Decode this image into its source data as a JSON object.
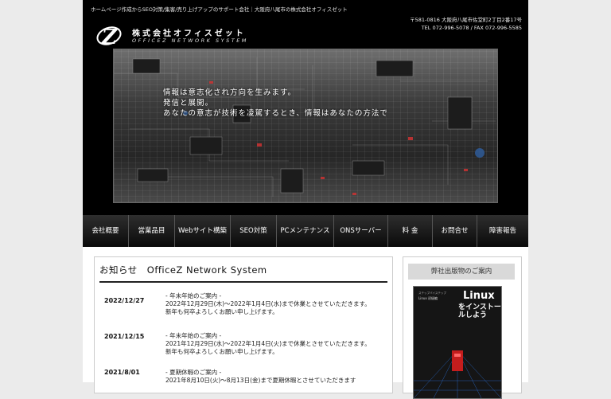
{
  "header": {
    "tagline": "ホームページ作成からSEO対策/集客/売り上げアップのサポート会社｜大阪府八尾市の株式会社オフィスゼット",
    "logo_letter": "Z",
    "company_name": "株式会社オフィスゼット",
    "company_name_en": "OFFICEZ NETWORK SYSTEM",
    "address": "〒581-0816 大阪府八尾市佐堂町2丁目2番17号",
    "contact": "TEL 072-996-5078 / FAX 072-996-5585"
  },
  "hero": {
    "lines": [
      "情報は意志化され方向を生みます。",
      "発信と展開。",
      "あなたの意志が技術を凌駕するとき、情報はあなたの方法で"
    ]
  },
  "nav": {
    "items": [
      {
        "label": "会社概要"
      },
      {
        "label": "営業品目"
      },
      {
        "label": "Webサイト構築"
      },
      {
        "label": "SEO対策"
      },
      {
        "label": "PCメンテナンス"
      },
      {
        "label": "ONSサーバー"
      },
      {
        "label": "料 金"
      },
      {
        "label": "お問合せ"
      },
      {
        "label": "障害報告"
      }
    ]
  },
  "news": {
    "title": "お知らせ　OfficeZ Network System",
    "entries": [
      {
        "date": "2022/12/27",
        "lines": [
          "- 年末年始のご案内 -",
          "2022年12月29日(木)～2022年1月4日(水)まで休業とさせていただきます。",
          "新年も何卒よろしくお願い申し上げます。"
        ]
      },
      {
        "date": "2021/12/15",
        "lines": [
          "- 年末年始のご案内 -",
          "2021年12月29日(水)～2022年1月4日(火)まで休業とさせていただきます。",
          "新年も何卒よろしくお願い申し上げます。"
        ]
      },
      {
        "date": "2021/8/01",
        "lines": [
          "- 夏期休暇のご案内 -",
          "2021年8月10日(火)～8月13日(金)まで夏期休暇とさせていただきます"
        ]
      }
    ]
  },
  "sidebar": {
    "title": "弊社出版物のご案内",
    "book": {
      "series": "ステップバイステップ",
      "author": "Linux 初級編",
      "title": "Linux",
      "subtitle": "をインストールしよう"
    }
  }
}
